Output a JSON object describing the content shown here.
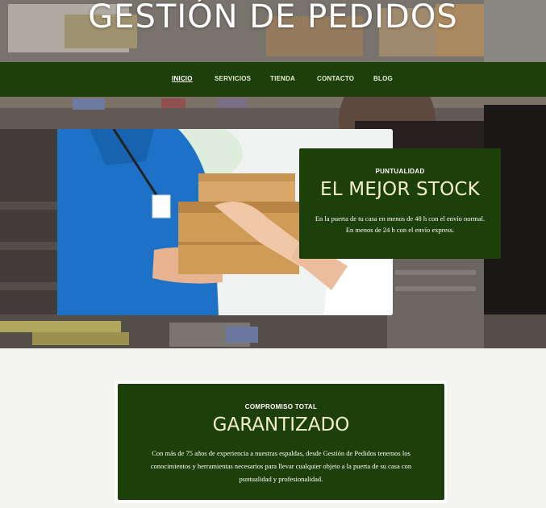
{
  "site": {
    "title": "GESTIÓN DE PEDIDOS"
  },
  "nav": {
    "items": [
      {
        "label": "INICIO",
        "active": true
      },
      {
        "label": "SERVICIOS",
        "active": false
      },
      {
        "label": "TIENDA",
        "active": false
      },
      {
        "label": "CONTACTO",
        "active": false
      },
      {
        "label": "BLOG",
        "active": false
      }
    ]
  },
  "hero": {
    "kicker": "PUNTUALIDAD",
    "headline": "EL MEJOR STOCK",
    "body": "En la puerta de tu casa en menos de 48 h con el envío normal. En menos de 24 h con el envío express."
  },
  "section": {
    "kicker": "COMPROMISO TOTAL",
    "headline": "GARANTIZADO",
    "body": "Con más de 75 años de experiencia a nuestras espaldas, desde Gestión de Pedidos tenemos los conocimientos y herramientas necesarios para llevar cualquier objeto a la puerta de su casa con puntualidad y profesionalidad."
  },
  "colors": {
    "brand_green": "#1d3f09",
    "headline_cream": "#f4f1c9",
    "page_bg": "#f3f4ef"
  }
}
